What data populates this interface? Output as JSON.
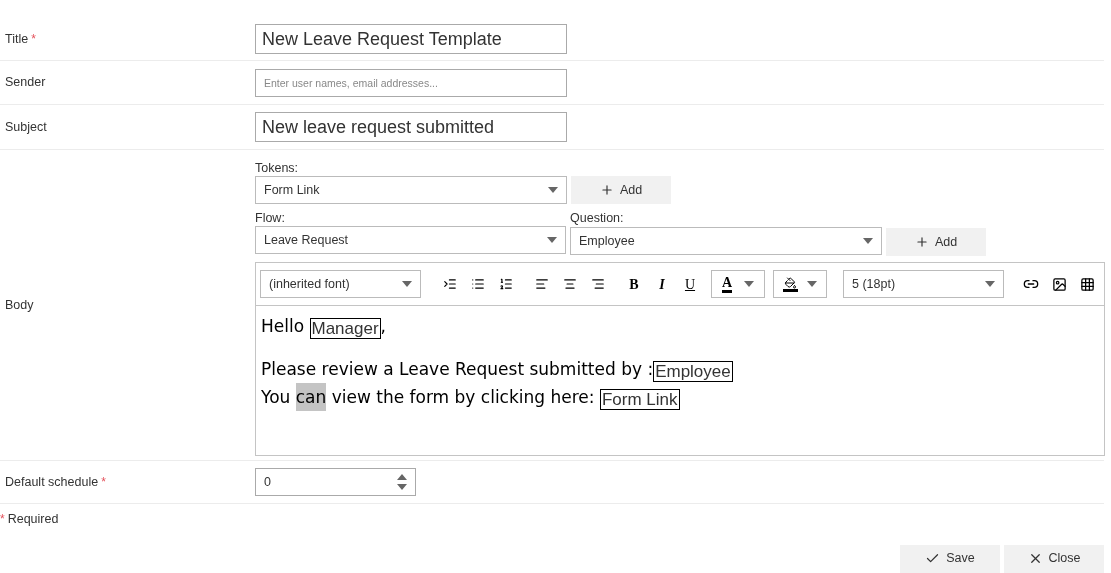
{
  "title_row": {
    "label": "Title",
    "required": true,
    "value": "New Leave Request Template"
  },
  "sender_row": {
    "label": "Sender",
    "placeholder": "Enter user names, email addresses..."
  },
  "subject_row": {
    "label": "Subject",
    "value": "New leave request submitted"
  },
  "body_row": {
    "label": "Body",
    "tokens": {
      "label": "Tokens:",
      "value": "Form Link",
      "add": "Add"
    },
    "flow": {
      "label": "Flow:",
      "value": "Leave Request"
    },
    "question": {
      "label": "Question:",
      "value": "Employee",
      "add": "Add"
    },
    "toolbar": {
      "font": "(inherited font)",
      "format_buttons": [
        "B",
        "I",
        "U"
      ],
      "font_color_glyph": "A",
      "size": "5 (18pt)"
    },
    "paragraphs": [
      {
        "lines": [
          {
            "segments": [
              {
                "kind": "text",
                "text": "Hello "
              },
              {
                "kind": "token",
                "text": "Manager"
              },
              {
                "kind": "text",
                "text": ","
              }
            ]
          }
        ]
      },
      {
        "lines": [
          {
            "segments": [
              {
                "kind": "text",
                "text": "Please review a Leave Request submitted by :"
              },
              {
                "kind": "token",
                "text": "Employee"
              }
            ]
          },
          {
            "segments": [
              {
                "kind": "text",
                "text": "You "
              },
              {
                "kind": "highlight",
                "text": "can"
              },
              {
                "kind": "text",
                "text": " view the form by clicking here: "
              },
              {
                "kind": "token",
                "text": "Form Link"
              }
            ]
          }
        ]
      }
    ]
  },
  "schedule_row": {
    "label": "Default schedule",
    "required": true,
    "value": "0"
  },
  "required_note": {
    "mark": "*",
    "text": "Required"
  },
  "buttons": [
    {
      "kind": "save",
      "label": "Save"
    },
    {
      "kind": "close",
      "label": "Close"
    }
  ]
}
